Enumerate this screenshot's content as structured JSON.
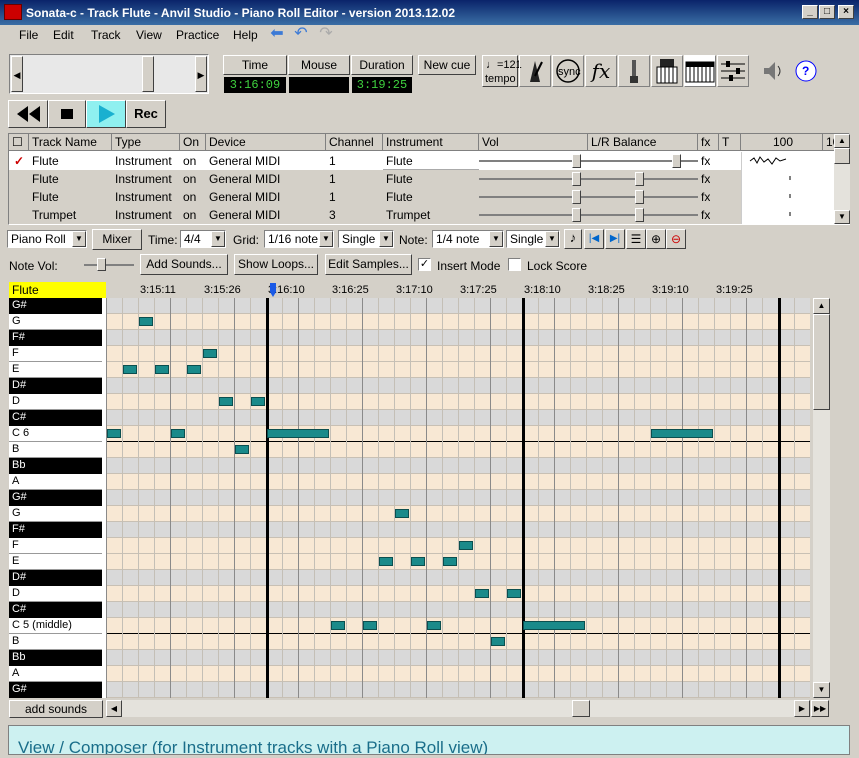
{
  "window": {
    "title": "Sonata-c - Track Flute - Anvil Studio - Piano Roll Editor - version 2013.12.02"
  },
  "menu": [
    "File",
    "Edit",
    "Track",
    "View",
    "Practice",
    "Help"
  ],
  "transport": {
    "time_label": "Time",
    "time_value": "3:16:09",
    "mouse_label": "Mouse",
    "mouse_value": "",
    "duration_label": "Duration",
    "duration_value": "3:19:25",
    "new_cue": "New cue",
    "tempo_value": "♩=121",
    "tempo_label": "tempo",
    "rec": "Rec"
  },
  "tools": [
    "metronome-icon",
    "sync-icon",
    "fx-icon",
    "tuning-fork-icon",
    "synth-icon",
    "keyboard-icon",
    "mixer-sliders-icon",
    "speaker-icon",
    "help-icon"
  ],
  "tool_text": {
    "sync": "sync",
    "fx": "fx",
    "help": "?"
  },
  "tracks": {
    "headers": [
      "Track Name",
      "Type",
      "On",
      "Device",
      "Channel",
      "Instrument",
      "Vol",
      "L/R Balance",
      "fx",
      "T",
      "100",
      "10"
    ],
    "rows": [
      {
        "name": "Flute",
        "type": "Instrument",
        "on": "on",
        "device": "General MIDI",
        "channel": "1",
        "instrument": "Flute",
        "fx": "fx",
        "selected": true
      },
      {
        "name": "Flute",
        "type": "Instrument",
        "on": "on",
        "device": "General MIDI",
        "channel": "1",
        "instrument": "Flute",
        "fx": "fx"
      },
      {
        "name": "Flute",
        "type": "Instrument",
        "on": "on",
        "device": "General MIDI",
        "channel": "1",
        "instrument": "Flute",
        "fx": "fx"
      },
      {
        "name": "Trumpet",
        "type": "Instrument",
        "on": "on",
        "device": "General MIDI",
        "channel": "3",
        "instrument": "Trumpet",
        "fx": "fx"
      }
    ]
  },
  "editbar": {
    "view": "Piano Roll",
    "mixer": "Mixer",
    "time_label": "Time:",
    "time_sig": "4/4",
    "grid_label": "Grid:",
    "grid": "1/16 note",
    "grid_mode": "Single",
    "note_label": "Note:",
    "note": "1/4 note",
    "note_mode": "Single"
  },
  "bar2": {
    "note_vol": "Note Vol:",
    "add_sounds": "Add Sounds...",
    "show_loops": "Show Loops...",
    "edit_samples": "Edit Samples...",
    "insert_mode": "Insert Mode",
    "lock_score": "Lock Score"
  },
  "roll": {
    "track": "Flute",
    "times": [
      "3:15:11",
      "3:15:26",
      "3:16:10",
      "3:16:25",
      "3:17:10",
      "3:17:25",
      "3:18:10",
      "3:18:25",
      "3:19:10",
      "3:19:25"
    ],
    "keys": [
      {
        "n": "G#",
        "b": true
      },
      {
        "n": "G"
      },
      {
        "n": "F#",
        "b": true
      },
      {
        "n": "F"
      },
      {
        "n": "E"
      },
      {
        "n": "D#",
        "b": true
      },
      {
        "n": "D"
      },
      {
        "n": "C#",
        "b": true
      },
      {
        "n": "C 6"
      },
      {
        "n": "B"
      },
      {
        "n": "Bb",
        "b": true
      },
      {
        "n": "A"
      },
      {
        "n": "G#",
        "b": true
      },
      {
        "n": "G"
      },
      {
        "n": "F#",
        "b": true
      },
      {
        "n": "F"
      },
      {
        "n": "E"
      },
      {
        "n": "D#",
        "b": true
      },
      {
        "n": "D"
      },
      {
        "n": "C#",
        "b": true
      },
      {
        "n": "C 5 (middle)"
      },
      {
        "n": "B"
      },
      {
        "n": "Bb",
        "b": true
      },
      {
        "n": "A"
      },
      {
        "n": "G#",
        "b": true
      }
    ],
    "add_sounds": "add sounds",
    "colors": {
      "note": "#1a8a8a",
      "light_row": "#f8e8d4",
      "grey_row": "#d9d9d9"
    }
  },
  "help": "View / Composer (for Instrument tracks with a Piano Roll view)"
}
